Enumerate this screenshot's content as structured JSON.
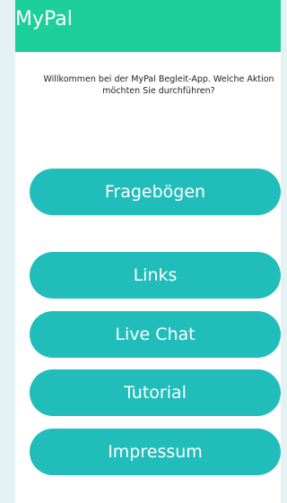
{
  "app_bar": {
    "title": "MyPal"
  },
  "welcome": {
    "text": "Willkommen bei der MyPal Begleit-App. Welche Aktion möchten Sie durchführen?"
  },
  "actions": [
    {
      "label": "Fragebögen"
    },
    {
      "label": "Links"
    },
    {
      "label": "Live Chat"
    },
    {
      "label": "Tutorial"
    },
    {
      "label": "Impressum"
    }
  ],
  "colors": {
    "app_bar": "#1dcf98",
    "button": "#21bdbb",
    "page_background": "#e4f2f3"
  }
}
